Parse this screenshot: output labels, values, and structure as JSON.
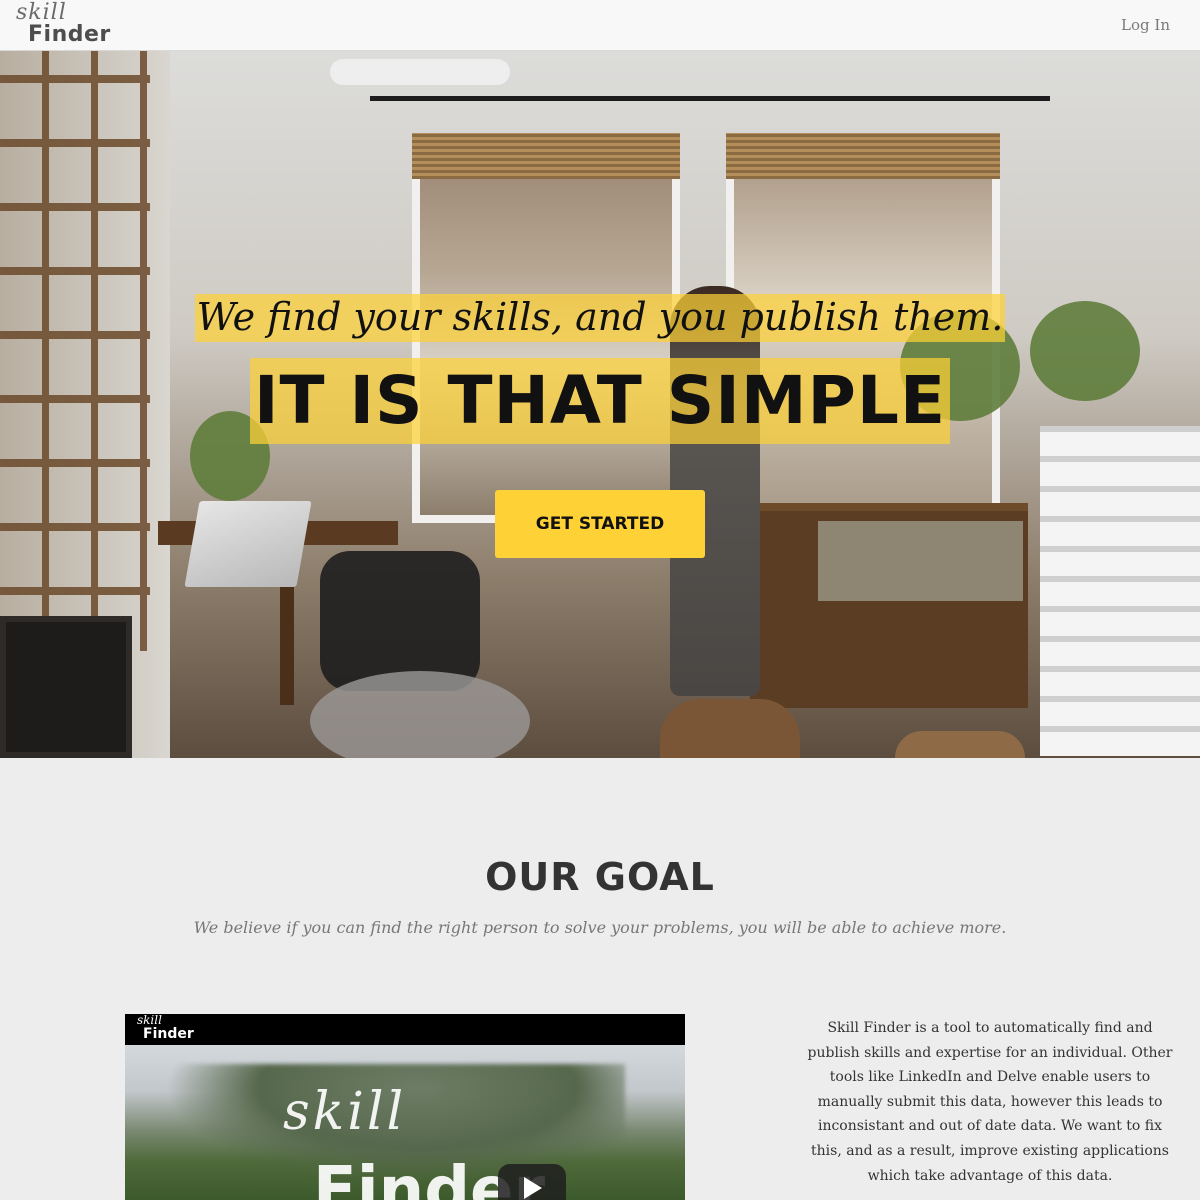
{
  "navbar": {
    "logo_script": "skill",
    "logo_word": "Finder",
    "login_label": "Log In"
  },
  "hero": {
    "subheading": "We find your skills, and you publish them.",
    "heading": "IT IS THAT SIMPLE",
    "cta_label": "GET STARTED"
  },
  "goal": {
    "title": "OUR GOAL",
    "subtitle": "We believe if you can find the right person to solve your problems, you will be able to achieve more.",
    "description": "Skill Finder is a tool to automatically find and publish skills and expertise for an individual. Other tools like LinkedIn and Delve enable users to manually submit this data, however this leads to inconsistant and out of date data. We want to fix this, and as a result, improve existing applications which take advantage of this data."
  },
  "video": {
    "bar_logo_script": "skill",
    "bar_logo_word": "Finder",
    "logo_script": "skill",
    "logo_word": "Finder",
    "play_icon": "play-icon"
  },
  "colors": {
    "accent": "#fed136",
    "heading_text": "#333333",
    "section_background": "#ededed",
    "navbar_background": "#f8f8f8"
  }
}
